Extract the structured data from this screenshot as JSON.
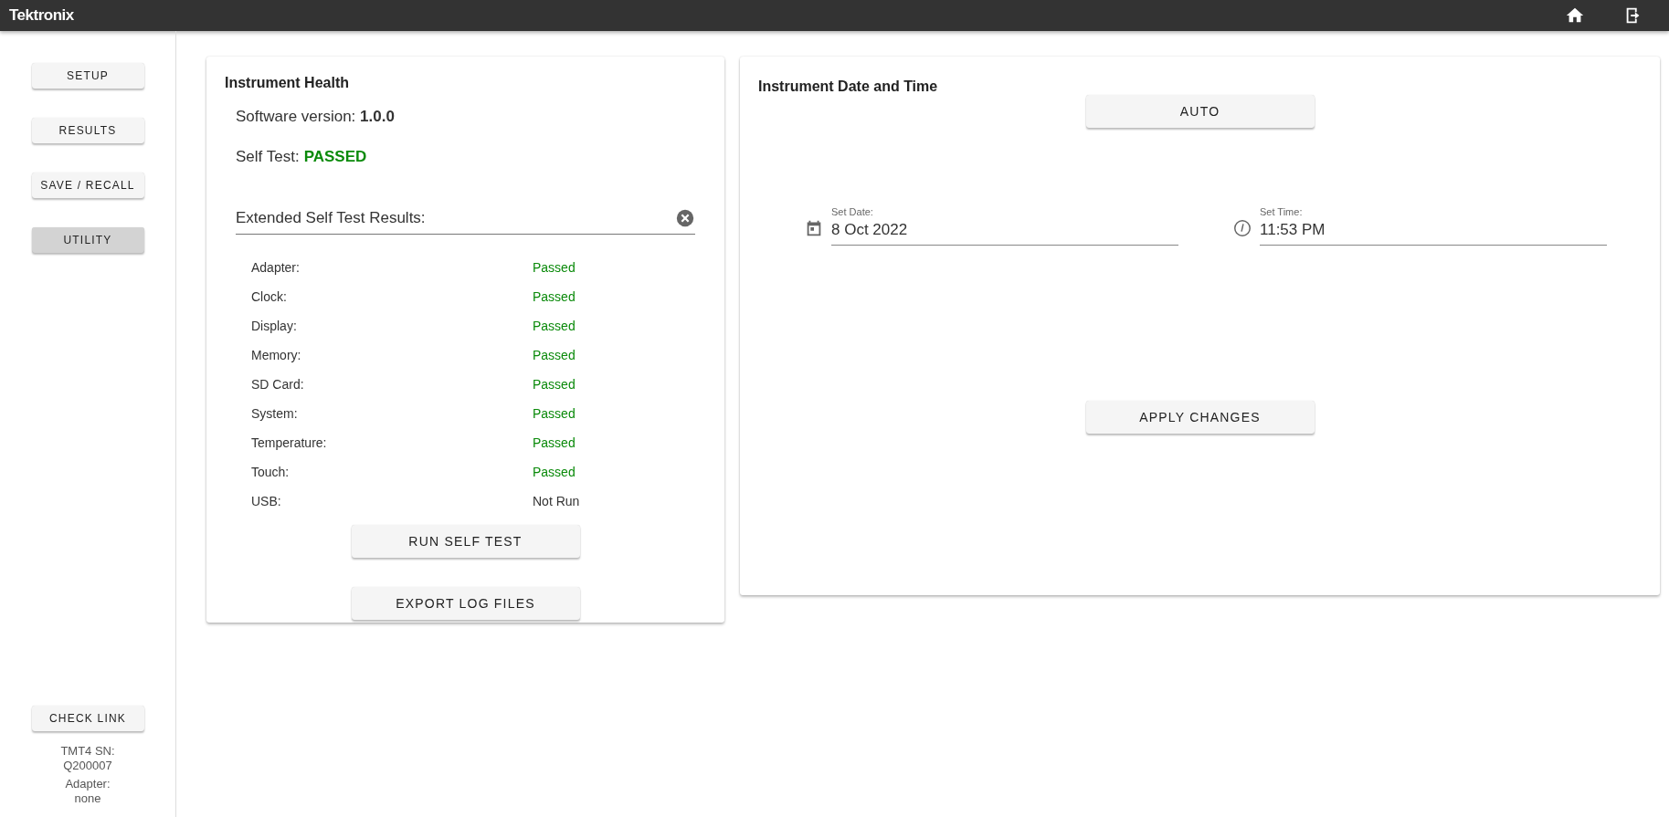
{
  "header": {
    "logo": "Tektronix"
  },
  "sidebar": {
    "items": [
      {
        "label": "SETUP",
        "selected": false
      },
      {
        "label": "RESULTS",
        "selected": false
      },
      {
        "label": "SAVE / RECALL",
        "selected": false
      },
      {
        "label": "UTILITY",
        "selected": true
      }
    ],
    "check_link": "CHECK LINK",
    "serial_label": "TMT4 SN:",
    "serial": "Q200007",
    "adapter_label": "Adapter:",
    "adapter": "none"
  },
  "health": {
    "title": "Instrument Health",
    "software_version": "Software version: **1.0.0**",
    "self_test_label": "Self Test:",
    "self_test_result": "PASSED",
    "self_test_passed": true,
    "extended_label": "Extended Self Test Results:",
    "tests": [
      {
        "name": "Adapter:",
        "status": "Passed",
        "passed": true
      },
      {
        "name": "Clock:",
        "status": "Passed",
        "passed": true
      },
      {
        "name": "Display:",
        "status": "Passed",
        "passed": true
      },
      {
        "name": "Memory:",
        "status": "Passed",
        "passed": true
      },
      {
        "name": "SD Card:",
        "status": "Passed",
        "passed": true
      },
      {
        "name": "System:",
        "status": "Passed",
        "passed": true
      },
      {
        "name": "Temperature:",
        "status": "Passed",
        "passed": true
      },
      {
        "name": "Touch:",
        "status": "Passed",
        "passed": true
      },
      {
        "name": "USB:",
        "status": "Not Run",
        "passed": false
      }
    ],
    "buttons": [
      "RUN SELF TEST",
      "EXPORT LOG FILES"
    ]
  },
  "datetime": {
    "title": "Instrument Date and Time",
    "auto_button": "AUTO",
    "date_label": "Set Date:",
    "date": "8 Oct 2022",
    "time_label": "Set Time:",
    "time": "11:53 PM",
    "apply_button": "APPLY CHANGES"
  }
}
